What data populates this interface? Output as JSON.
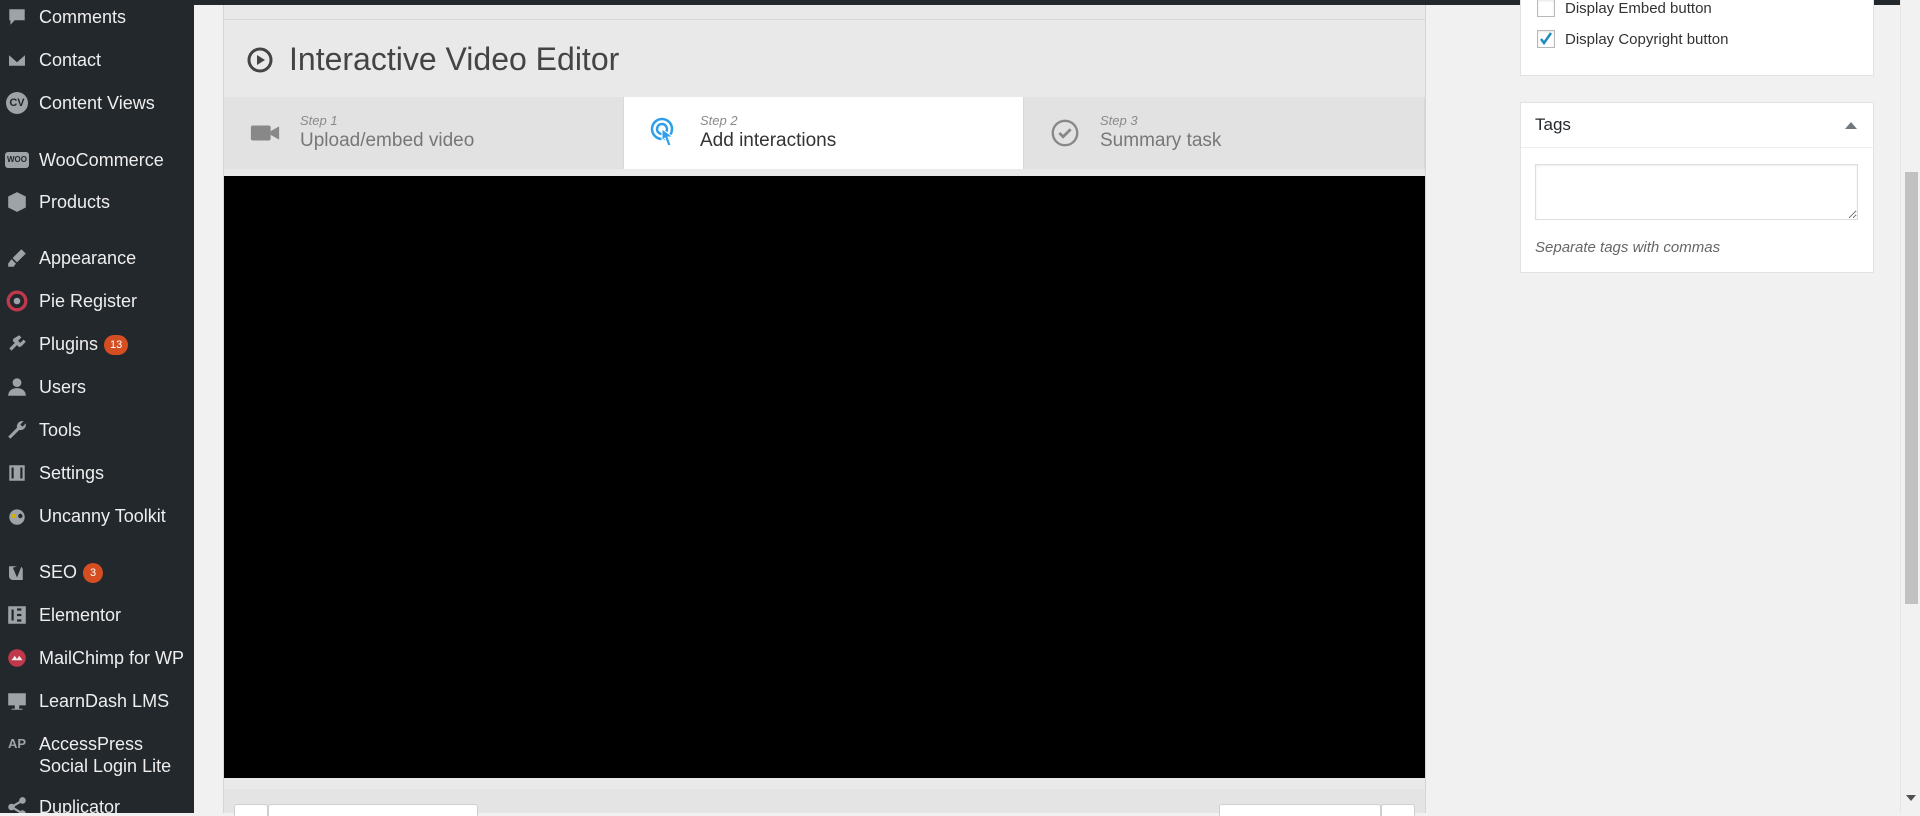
{
  "sidebar": {
    "items": [
      {
        "label": "Comments",
        "icon": "comment-icon"
      },
      {
        "label": "Contact",
        "icon": "mail-icon"
      },
      {
        "label": "Content Views",
        "icon": "cv-icon"
      },
      {
        "label": "WooCommerce",
        "icon": "woocommerce-icon"
      },
      {
        "label": "Products",
        "icon": "box-icon"
      },
      {
        "label": "Appearance",
        "icon": "paintbrush-icon"
      },
      {
        "label": "Pie Register",
        "icon": "target-icon"
      },
      {
        "label": "Plugins",
        "icon": "plug-icon",
        "badge": "13"
      },
      {
        "label": "Users",
        "icon": "user-icon"
      },
      {
        "label": "Tools",
        "icon": "wrench-icon"
      },
      {
        "label": "Settings",
        "icon": "sliders-icon"
      },
      {
        "label": "Uncanny Toolkit",
        "icon": "owl-icon"
      },
      {
        "label": "SEO",
        "icon": "yoast-icon",
        "badge": "3"
      },
      {
        "label": "Elementor",
        "icon": "elementor-icon"
      },
      {
        "label": "MailChimp for WP",
        "icon": "mailchimp-icon"
      },
      {
        "label": "LearnDash LMS",
        "icon": "monitor-icon"
      },
      {
        "label": "AccessPress Social Login Lite",
        "icon": "ap-icon"
      },
      {
        "label": "Duplicator",
        "icon": "share-icon"
      }
    ]
  },
  "editor": {
    "title": "Interactive Video Editor",
    "steps": [
      {
        "num": "Step 1",
        "label": "Upload/embed video",
        "icon": "video-camera-icon",
        "active": false
      },
      {
        "num": "Step 2",
        "label": "Add interactions",
        "icon": "tap-icon",
        "active": true
      },
      {
        "num": "Step 3",
        "label": "Summary task",
        "icon": "check-circle-icon",
        "active": false
      }
    ]
  },
  "side": {
    "embed_label": "Display Embed button",
    "copyright_label": "Display Copyright button",
    "copyright_checked": true,
    "tags_title": "Tags",
    "tags_help": "Separate tags with commas"
  },
  "colors": {
    "sidebar_bg": "#23282d",
    "badge": "#d54e21",
    "accent_blue": "#2e9fe8",
    "check_blue": "#1e8cbe"
  }
}
